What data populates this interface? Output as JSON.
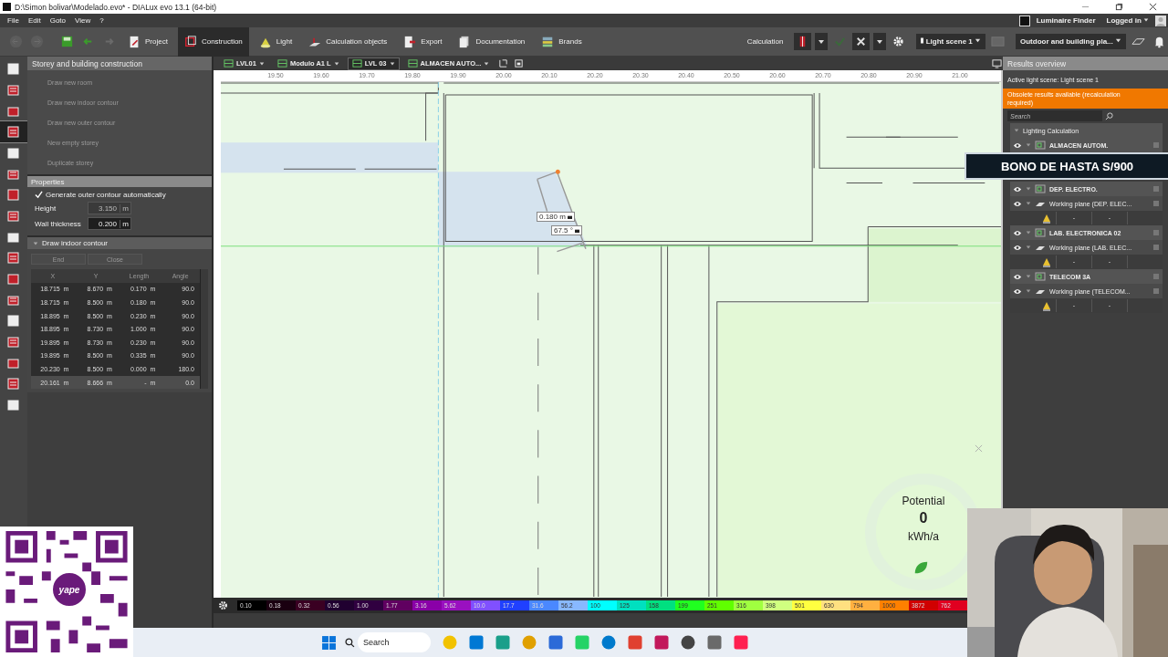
{
  "window": {
    "title": "D:\\Simon bolivar\\Modelado.evo* - DIALux evo 13.1  (64-bit)"
  },
  "menu": [
    "File",
    "Edit",
    "Goto",
    "View",
    "?"
  ],
  "account": {
    "finder": "Luminaire Finder",
    "login": "Logged in"
  },
  "toolbar": {
    "tabs": [
      {
        "label": "Project",
        "selected": false
      },
      {
        "label": "Construction",
        "selected": true
      },
      {
        "label": "Light",
        "selected": false
      },
      {
        "label": "Calculation objects",
        "selected": false
      },
      {
        "label": "Export",
        "selected": false
      },
      {
        "label": "Documentation",
        "selected": false
      },
      {
        "label": "Brands",
        "selected": false
      }
    ],
    "calculation_label": "Calculation",
    "light_scene": "Light scene 1",
    "view_mode": "Outdoor and building pla..."
  },
  "left_tools": [
    {
      "selected": false
    },
    {
      "selected": false
    },
    {
      "selected": false
    },
    {
      "selected": true
    },
    {
      "selected": false
    },
    {
      "selected": false
    },
    {
      "selected": false
    },
    {
      "selected": false
    },
    {
      "selected": false
    },
    {
      "selected": false
    },
    {
      "selected": false
    },
    {
      "selected": false
    },
    {
      "selected": false
    },
    {
      "selected": false
    },
    {
      "selected": false
    },
    {
      "selected": false
    },
    {
      "selected": false
    }
  ],
  "left_panel": {
    "title": "Storey and building construction",
    "actions": [
      {
        "label": "Draw new room",
        "disabled": true
      },
      {
        "label": "Draw new indoor contour",
        "disabled": true
      },
      {
        "label": "Draw new outer contour",
        "disabled": true
      },
      {
        "label": "New empty storey",
        "disabled": true
      },
      {
        "label": "Duplicate storey",
        "disabled": true
      }
    ],
    "properties": {
      "title": "Properties",
      "checkbox": {
        "label": "Generate outer contour automatically",
        "checked": true
      },
      "fields": [
        {
          "label": "Height",
          "value": "3.150",
          "unit": "m",
          "disabled": true
        },
        {
          "label": "Wall thickness",
          "value": "0.200",
          "unit": "m",
          "disabled": false
        }
      ]
    },
    "contour": {
      "title": "Draw indoor contour",
      "buttons": [
        {
          "label": "End",
          "disabled": true
        },
        {
          "label": "Close",
          "disabled": true
        }
      ],
      "columns": [
        "X",
        "Y",
        "Length",
        "Angle"
      ],
      "rows": [
        {
          "selected": false,
          "cells": [
            {
              "value": "18.715",
              "unit": "m"
            },
            {
              "value": "8.670",
              "unit": "m"
            },
            {
              "value": "0.170",
              "unit": "m"
            },
            {
              "value": "90.0"
            }
          ]
        },
        {
          "selected": false,
          "cells": [
            {
              "value": "18.715",
              "unit": "m"
            },
            {
              "value": "8.500",
              "unit": "m"
            },
            {
              "value": "0.180",
              "unit": "m"
            },
            {
              "value": "90.0"
            }
          ]
        },
        {
          "selected": false,
          "cells": [
            {
              "value": "18.895",
              "unit": "m"
            },
            {
              "value": "8.500",
              "unit": "m"
            },
            {
              "value": "0.230",
              "unit": "m"
            },
            {
              "value": "90.0"
            }
          ]
        },
        {
          "selected": false,
          "cells": [
            {
              "value": "18.895",
              "unit": "m"
            },
            {
              "value": "8.730",
              "unit": "m"
            },
            {
              "value": "1.000",
              "unit": "m"
            },
            {
              "value": "90.0"
            }
          ]
        },
        {
          "selected": false,
          "cells": [
            {
              "value": "19.895",
              "unit": "m"
            },
            {
              "value": "8.730",
              "unit": "m"
            },
            {
              "value": "0.230",
              "unit": "m"
            },
            {
              "value": "90.0"
            }
          ]
        },
        {
          "selected": false,
          "cells": [
            {
              "value": "19.895",
              "unit": "m"
            },
            {
              "value": "8.500",
              "unit": "m"
            },
            {
              "value": "0.335",
              "unit": "m"
            },
            {
              "value": "90.0"
            }
          ]
        },
        {
          "selected": false,
          "cells": [
            {
              "value": "20.230",
              "unit": "m"
            },
            {
              "value": "8.500",
              "unit": "m"
            },
            {
              "value": "0.000",
              "unit": "m"
            },
            {
              "value": "180.0"
            }
          ]
        },
        {
          "selected": true,
          "cells": [
            {
              "value": "20.161",
              "unit": "m"
            },
            {
              "value": "8.666",
              "unit": "m"
            },
            {
              "value": "-",
              "unit": "m"
            },
            {
              "value": "0.0"
            }
          ]
        }
      ]
    }
  },
  "view_tabs": [
    {
      "label": "LVL01",
      "selected": false
    },
    {
      "label": "Modulo A1 L",
      "selected": false
    },
    {
      "label": "LVL 03",
      "selected": true
    },
    {
      "label": "ALMACEN AUTO...",
      "selected": false
    }
  ],
  "ruler": [
    "19.50",
    "19.60",
    "19.70",
    "19.80",
    "19.90",
    "20.00",
    "20.10",
    "20.20",
    "20.30",
    "20.40",
    "20.50",
    "20.60",
    "20.70",
    "20.80",
    "20.90",
    "21.00"
  ],
  "canvas": {
    "dimension_label": "0.180 m",
    "angle_label": "67.5 °"
  },
  "potential": {
    "label": "Potential",
    "value": "0",
    "unit": "kWh/a"
  },
  "color_scale": [
    {
      "label": "0.10",
      "color": "#000000"
    },
    {
      "label": "0.18",
      "color": "#1a0010"
    },
    {
      "label": "0.32",
      "color": "#3a0022"
    },
    {
      "label": "0.56",
      "color": "#200030"
    },
    {
      "label": "1.00",
      "color": "#300040"
    },
    {
      "label": "1.77",
      "color": "#600060"
    },
    {
      "label": "3.16",
      "color": "#8a00a8"
    },
    {
      "label": "5.62",
      "color": "#9a10c0"
    },
    {
      "label": "10.0",
      "color": "#8050ff"
    },
    {
      "label": "17.7",
      "color": "#2040ff"
    },
    {
      "label": "31.6",
      "color": "#4a88ff"
    },
    {
      "label": "56.2",
      "color": "#88b8ff"
    },
    {
      "label": "100",
      "color": "#00ffff"
    },
    {
      "label": "125",
      "color": "#00e0c0"
    },
    {
      "label": "158",
      "color": "#00e080"
    },
    {
      "label": "199",
      "color": "#20ff20"
    },
    {
      "label": "251",
      "color": "#60ff00"
    },
    {
      "label": "316",
      "color": "#a0ff40"
    },
    {
      "label": "398",
      "color": "#d0ff80"
    },
    {
      "label": "501",
      "color": "#ffff40"
    },
    {
      "label": "630",
      "color": "#ffe080"
    },
    {
      "label": "794",
      "color": "#ffb040"
    },
    {
      "label": "1000",
      "color": "#ff8000"
    },
    {
      "label": "3872",
      "color": "#d00000"
    },
    {
      "label": "762",
      "color": "#e00020"
    }
  ],
  "right_panel": {
    "title": "Results overview",
    "active_scene": "Active light scene: Light scene 1",
    "warning": "Obsolete results available (recalculation required)",
    "search_placeholder": "Search",
    "tree": [
      {
        "label": "Lighting Calculation",
        "expanded": true,
        "children": [
          {
            "label": "ALMACEN AUTOM.",
            "expanded": true,
            "checked": false
          },
          {
            "label": "DEP. ELECTRO.",
            "expanded": true,
            "checked": false,
            "children": [
              {
                "label": "Working plane (DEP. ELEC...",
                "checked": false,
                "values": [
                  "-",
                  "-"
                ]
              }
            ]
          },
          {
            "label": "LAB. ELECTRONICA 02",
            "expanded": true,
            "checked": false,
            "children": [
              {
                "label": "Working plane (LAB. ELEC...",
                "checked": false,
                "values": [
                  "-",
                  "-"
                ]
              }
            ]
          },
          {
            "label": "TELECOM 3A",
            "expanded": true,
            "checked": false,
            "children": [
              {
                "label": "Working plane (TELECOM...",
                "checked": false,
                "values": [
                  "-",
                  "-"
                ]
              }
            ]
          }
        ]
      }
    ]
  },
  "banner": "BONO DE HASTA S/900",
  "qr": {
    "logo": "yape"
  },
  "taskbar": {
    "search_placeholder": "Search"
  }
}
